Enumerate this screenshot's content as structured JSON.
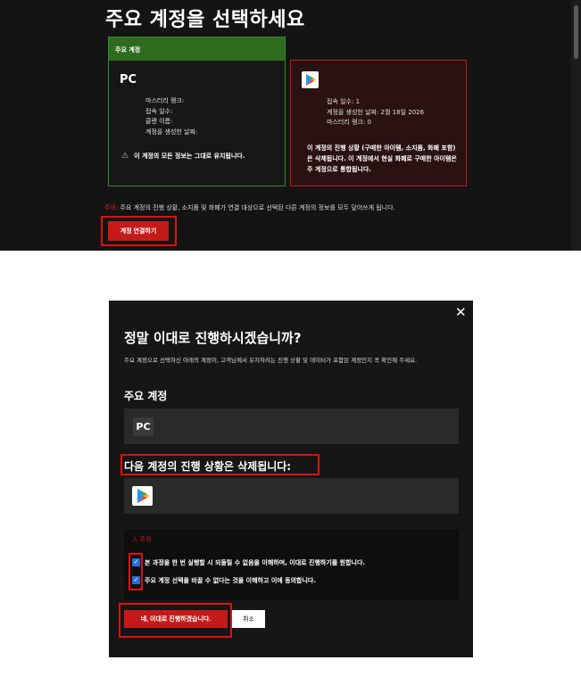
{
  "top": {
    "title": "주요 계정을 선택하세요",
    "pc_card": {
      "header": "주요 계정",
      "logo": "PC",
      "lines": [
        "마스터리 랭크:",
        "접속 일수:",
        "클랜 이름:",
        "계정을 생성한 날짜:"
      ],
      "warning": "이 계정의 모든 정보는 그대로 유지됩니다."
    },
    "gp_card": {
      "lines": [
        "접속 일수: 1",
        "계정을 생성한 날짜: 2월 18일 2026",
        "마스터리 랭크: 0"
      ],
      "warning": "이 계정의 진행 상황 (구매한 아이템, 소지품, 화폐 포함) 은 삭제됩니다. 이 계정에서 현실 화폐로 구매한 아이템은 주 계정으로 통합됩니다."
    },
    "notice_label": "주의:",
    "notice_text": " 주요 계정의 진행 상황, 소지품 및 화폐가 연결 대상으로 선택된 다른 계정의 정보를 모두 덮어쓰게 됩니다.",
    "link_button": "계정 연결하기"
  },
  "modal": {
    "close": "✕",
    "title": "정말 이대로 진행하시겠습니까?",
    "description": "주요 계정으로 선택하신 아래의 계정이, 고객님께서 유지하려는 진행 상황 및 데이터가 포함된 계정인지 꼭 확인해 주세요.",
    "main_section": "주요 계정",
    "pc_logo": "PC",
    "delete_section": "다음 계정의 진행 상황은 삭제됩니다:",
    "caution_title": "주의",
    "check1": "본 과정을 한 번 실행할 시 되돌릴 수 없음을 이해하며, 이대로 진행하기를 원합니다.",
    "check2": "주요 계정 선택을 바꿀 수 없다는 것을 이해하고 이에 동의합니다.",
    "confirm_button": "네, 이대로 진행하겠습니다.",
    "cancel_button": "취소"
  },
  "colors": {
    "accent_red": "#c41a1a",
    "highlight": "#e01010",
    "pc_green": "#2e8b2e",
    "checkbox_blue": "#2a6fd6"
  }
}
